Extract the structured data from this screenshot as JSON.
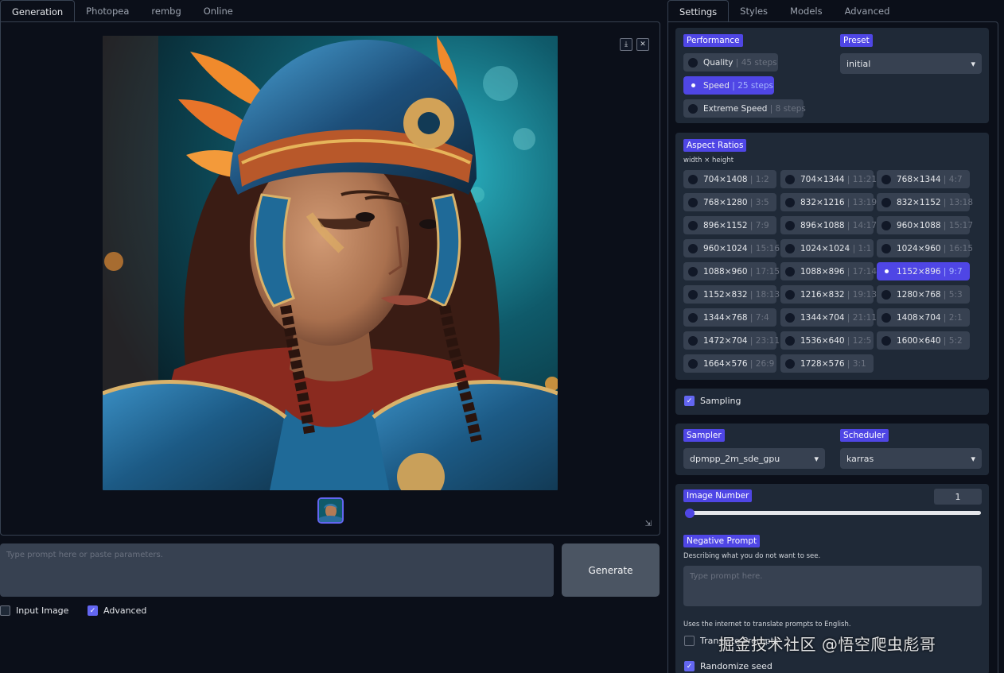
{
  "left_tabs": [
    "Generation",
    "Photopea",
    "rembg",
    "Online"
  ],
  "right_tabs": [
    "Settings",
    "Styles",
    "Models",
    "Advanced"
  ],
  "gallery": {
    "download_icon": "⤓",
    "close_icon": "✕",
    "resize_icon": "⇲"
  },
  "prompt": {
    "placeholder": "Type prompt here or paste parameters."
  },
  "generate_label": "Generate",
  "options": {
    "input_image": "Input Image",
    "advanced": "Advanced",
    "advanced_checked": true,
    "input_image_checked": false
  },
  "performance": {
    "label": "Performance",
    "items": [
      {
        "name": "Quality",
        "detail": "45 steps",
        "selected": false
      },
      {
        "name": "Speed",
        "detail": "25 steps",
        "selected": true
      },
      {
        "name": "Extreme Speed",
        "detail": "8 steps",
        "selected": false
      }
    ]
  },
  "preset": {
    "label": "Preset",
    "value": "initial"
  },
  "aspect": {
    "label": "Aspect Ratios",
    "sublabel": "width × height",
    "items": [
      {
        "size": "704×1408",
        "ratio": "1:2"
      },
      {
        "size": "704×1344",
        "ratio": "11:21"
      },
      {
        "size": "768×1344",
        "ratio": "4:7"
      },
      {
        "size": "768×1280",
        "ratio": "3:5"
      },
      {
        "size": "832×1216",
        "ratio": "13:19"
      },
      {
        "size": "832×1152",
        "ratio": "13:18"
      },
      {
        "size": "896×1152",
        "ratio": "7:9"
      },
      {
        "size": "896×1088",
        "ratio": "14:17"
      },
      {
        "size": "960×1088",
        "ratio": "15:17"
      },
      {
        "size": "960×1024",
        "ratio": "15:16"
      },
      {
        "size": "1024×1024",
        "ratio": "1:1"
      },
      {
        "size": "1024×960",
        "ratio": "16:15"
      },
      {
        "size": "1088×960",
        "ratio": "17:15"
      },
      {
        "size": "1088×896",
        "ratio": "17:14"
      },
      {
        "size": "1152×896",
        "ratio": "9:7",
        "selected": true
      },
      {
        "size": "1152×832",
        "ratio": "18:13"
      },
      {
        "size": "1216×832",
        "ratio": "19:13"
      },
      {
        "size": "1280×768",
        "ratio": "5:3"
      },
      {
        "size": "1344×768",
        "ratio": "7:4"
      },
      {
        "size": "1344×704",
        "ratio": "21:11"
      },
      {
        "size": "1408×704",
        "ratio": "2:1"
      },
      {
        "size": "1472×704",
        "ratio": "23:11"
      },
      {
        "size": "1536×640",
        "ratio": "12:5"
      },
      {
        "size": "1600×640",
        "ratio": "5:2"
      },
      {
        "size": "1664×576",
        "ratio": "26:9"
      },
      {
        "size": "1728×576",
        "ratio": "3:1"
      }
    ]
  },
  "sampling": {
    "label": "Sampling",
    "checked": true
  },
  "sampler": {
    "label": "Sampler",
    "value": "dpmpp_2m_sde_gpu"
  },
  "scheduler": {
    "label": "Scheduler",
    "value": "karras"
  },
  "image_number": {
    "label": "Image Number",
    "value": "1",
    "fraction": 0.0
  },
  "negative_prompt": {
    "label": "Negative Prompt",
    "sublabel": "Describing what you do not want to see.",
    "placeholder": "Type prompt here."
  },
  "translate": {
    "note": "Uses the internet to translate prompts to English.",
    "label": "Translate Prompts",
    "checked": false
  },
  "randomize": {
    "label": "Randomize seed",
    "checked": true
  },
  "watermark": "掘金技术社区 @悟空爬虫彪哥",
  "colors": {
    "accent": "#4f46e5",
    "bg": "#0b0f19",
    "panel": "#1f2937",
    "control": "#374151"
  }
}
